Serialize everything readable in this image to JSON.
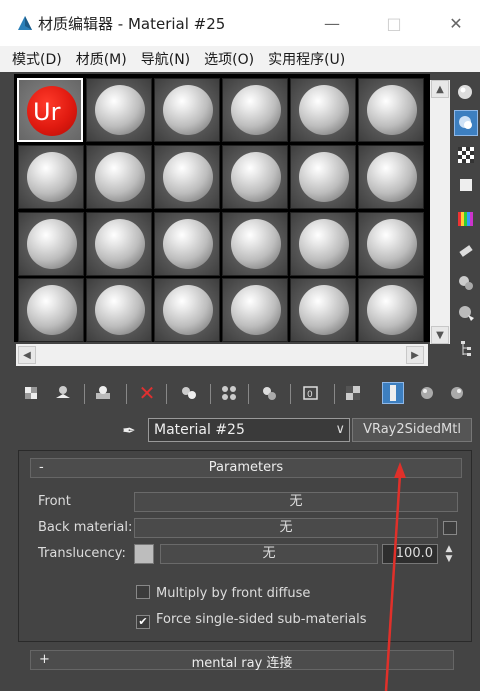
{
  "window": {
    "title": "材质编辑器 - Material #25",
    "minimize": "—",
    "maximize": "□",
    "close": "✕"
  },
  "menu": [
    "模式(D)",
    "材质(M)",
    "导航(N)",
    "选项(O)",
    "实用程序(U)"
  ],
  "slots": {
    "active_label": "Ur",
    "rows": 4,
    "cols": 6
  },
  "scroll": {
    "up": "▲",
    "down": "▼",
    "left": "◀",
    "right": "▶"
  },
  "material": {
    "eyedropper": "✒",
    "name": "Material #25",
    "dropdown_arrow": "∨",
    "type": "VRay2SidedMtl"
  },
  "parameters": {
    "sign": "-",
    "title": "Parameters",
    "front_label": "Front",
    "front_value": "无",
    "back_label": "Back material:",
    "back_value": "无",
    "translucency_label": "Translucency:",
    "translucency_map": "无",
    "translucency_amount": "100.0",
    "multiply_label": "Multiply by front diffuse",
    "multiply_checked": "",
    "force_label": "Force single-sided sub-materials",
    "force_checked": "✔"
  },
  "mental_ray": {
    "sign": "+",
    "title": "mental ray 连接"
  },
  "colors": {
    "panel_bg": "#444444",
    "active_slot": "#e01a10",
    "annotation_arrow": "#e0302a"
  }
}
